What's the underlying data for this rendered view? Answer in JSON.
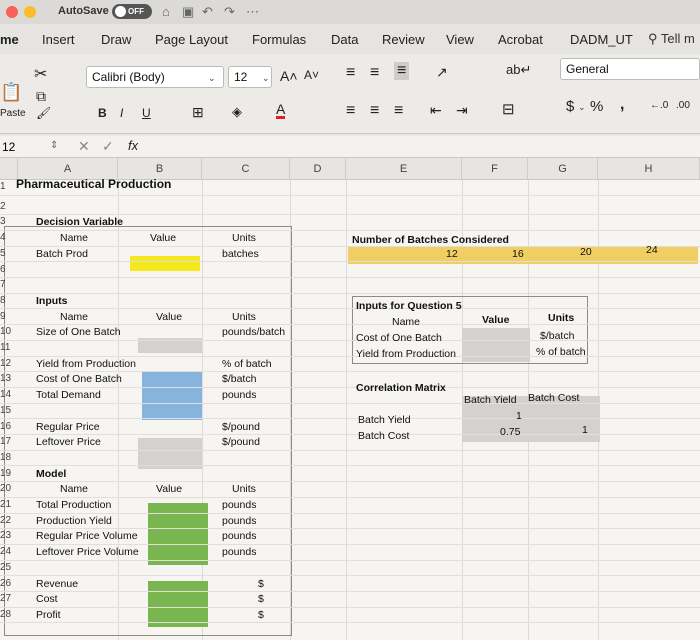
{
  "titlebar": {
    "autosave": "AutoSave",
    "toggle": "OFF"
  },
  "tabs": [
    "me",
    "Insert",
    "Draw",
    "Page Layout",
    "Formulas",
    "Data",
    "Review",
    "View",
    "Acrobat",
    "DADM_UT"
  ],
  "tell_me": "Tell m",
  "ribbon": {
    "paste": "Paste",
    "font_name": "Calibri (Body)",
    "font_size": "12",
    "bold": "B",
    "italic": "I",
    "underline": "U",
    "number_format": "General",
    "currency": "$",
    "percent": "%",
    "comma": ","
  },
  "formula_bar": {
    "name_box": "12",
    "fx": "fx"
  },
  "columns": [
    "A",
    "B",
    "C",
    "D",
    "E",
    "F",
    "G",
    "H"
  ],
  "rows": [
    {
      "n": "1",
      "a": "Pharmaceutical Production"
    },
    {
      "n": "2"
    },
    {
      "n": "3",
      "a": "Decision Variable"
    },
    {
      "n": "4",
      "a": "Name",
      "b": "Value",
      "c": "Units"
    },
    {
      "n": "5",
      "a": "Batch Prod",
      "c": "batches"
    },
    {
      "n": "6"
    },
    {
      "n": "7"
    },
    {
      "n": "8",
      "a": "Inputs"
    },
    {
      "n": "9",
      "a": "Name",
      "b": "Value",
      "c": "Units"
    },
    {
      "n": "10",
      "a": "Size of One Batch",
      "c": "pounds/batch"
    },
    {
      "n": "11"
    },
    {
      "n": "12",
      "a": "Yield from Production",
      "c": "% of batch"
    },
    {
      "n": "13",
      "a": "Cost of One Batch",
      "c": "$/batch"
    },
    {
      "n": "14",
      "a": "Total Demand",
      "c": "pounds"
    },
    {
      "n": "15"
    },
    {
      "n": "16",
      "a": "Regular Price",
      "c": "$/pound"
    },
    {
      "n": "17",
      "a": "Leftover Price",
      "c": "$/pound"
    },
    {
      "n": "18"
    },
    {
      "n": "19",
      "a": "Model"
    },
    {
      "n": "20",
      "a": "Name",
      "b": "Value",
      "c": "Units"
    },
    {
      "n": "21",
      "a": "Total Production",
      "c": "pounds"
    },
    {
      "n": "22",
      "a": "Production Yield",
      "c": "pounds"
    },
    {
      "n": "23",
      "a": "Regular Price Volume",
      "c": "pounds"
    },
    {
      "n": "24",
      "a": "Leftover Price Volume",
      "c": "pounds"
    },
    {
      "n": "25"
    },
    {
      "n": "26",
      "a": "Revenue",
      "c": "$"
    },
    {
      "n": "27",
      "a": "Cost",
      "c": "$"
    },
    {
      "n": "28",
      "a": "Profit",
      "c": "$"
    }
  ],
  "right": {
    "batches_label": "Number of Batches Considered",
    "batches": [
      "12",
      "16",
      "20",
      "24"
    ],
    "q5_title": "Inputs for Question 5",
    "q5_name": "Name",
    "q5_value": "Value",
    "q5_units": "Units",
    "q5_row1": "Cost of One Batch",
    "q5_row1_units": "$/batch",
    "q5_row2": "Yield from Production",
    "q5_row2_units": "% of batch",
    "corr_title": "Correlation Matrix",
    "corr_col1": "Batch Yield",
    "corr_col2": "Batch Cost",
    "corr_row1": "Batch Yield",
    "corr_row2": "Batch Cost",
    "corr_v11": "1",
    "corr_v21": "0.75",
    "corr_v22": "1"
  },
  "colors": {
    "yellow": "#f5e81d",
    "blue": "#86b4dc",
    "green": "#79b650",
    "gold": "#f1ce62",
    "grey": "#d4d2ce"
  }
}
